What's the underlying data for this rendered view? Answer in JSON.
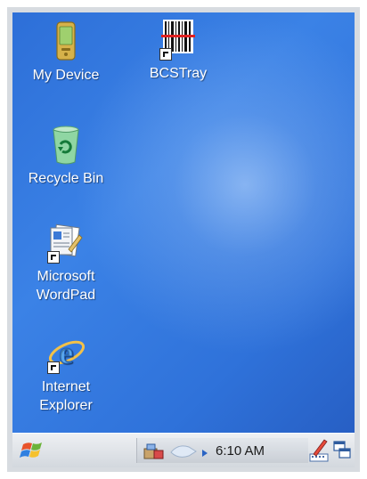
{
  "desktop": {
    "icons": [
      {
        "label": "My Device",
        "icon": "pda-device-icon"
      },
      {
        "label": "BCSTray",
        "icon": "barcode-scanner-icon",
        "shortcut": true
      },
      {
        "label": "Recycle Bin",
        "icon": "recycle-bin-icon"
      },
      {
        "label_line1": "Microsoft",
        "label_line2": "WordPad",
        "icon": "wordpad-icon",
        "shortcut": true
      },
      {
        "label_line1": "Internet",
        "label_line2": "Explorer",
        "icon": "internet-explorer-icon",
        "shortcut": true
      }
    ],
    "background_color": "#3b82e6"
  },
  "taskbar": {
    "start_icon": "windows-start-icon",
    "tray": {
      "items": [
        "network-connection-icon",
        "wireless-signal-icon",
        "tray-expand-arrow-icon"
      ],
      "clock": "6:10 AM"
    },
    "input_panel_icon": "input-panel-pen-icon",
    "show_desktop_icon": "show-desktop-icon"
  }
}
